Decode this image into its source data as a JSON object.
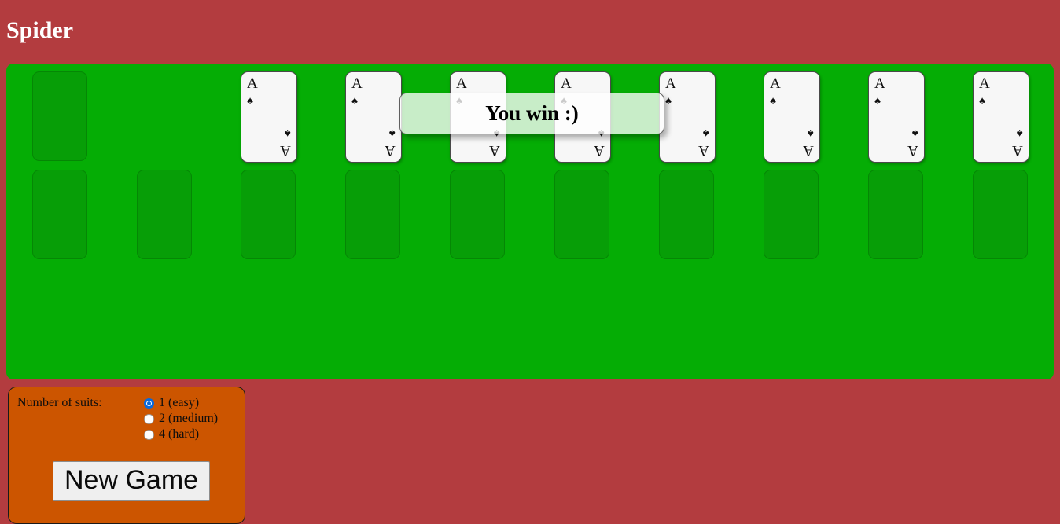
{
  "page": {
    "title": "Spider",
    "background_color": "#b33c3f"
  },
  "table": {
    "felt_color": "#05ad05",
    "slot_color": "#079e07",
    "columns": 10,
    "rows": [
      {
        "name": "top-row",
        "cells": [
          {
            "type": "empty"
          },
          {
            "type": "blank"
          },
          {
            "type": "card",
            "rank": "A",
            "suit": "♠",
            "suit_name": "spades",
            "color": "black"
          },
          {
            "type": "card",
            "rank": "A",
            "suit": "♠",
            "suit_name": "spades",
            "color": "black"
          },
          {
            "type": "card",
            "rank": "A",
            "suit": "♠",
            "suit_name": "spades",
            "color": "black"
          },
          {
            "type": "card",
            "rank": "A",
            "suit": "♠",
            "suit_name": "spades",
            "color": "black"
          },
          {
            "type": "card",
            "rank": "A",
            "suit": "♠",
            "suit_name": "spades",
            "color": "black"
          },
          {
            "type": "card",
            "rank": "A",
            "suit": "♠",
            "suit_name": "spades",
            "color": "black"
          },
          {
            "type": "card",
            "rank": "A",
            "suit": "♠",
            "suit_name": "spades",
            "color": "black"
          },
          {
            "type": "card",
            "rank": "A",
            "suit": "♠",
            "suit_name": "spades",
            "color": "black"
          }
        ]
      },
      {
        "name": "second-row",
        "cells": [
          {
            "type": "empty"
          },
          {
            "type": "empty"
          },
          {
            "type": "empty"
          },
          {
            "type": "empty"
          },
          {
            "type": "empty"
          },
          {
            "type": "empty"
          },
          {
            "type": "empty"
          },
          {
            "type": "empty"
          },
          {
            "type": "empty"
          },
          {
            "type": "empty"
          }
        ]
      }
    ]
  },
  "win_message": {
    "text": "You win :)"
  },
  "controls": {
    "panel_color": "#cc5500",
    "suits_label": "Number of suits:",
    "suit_options": [
      {
        "label": "1 (easy)",
        "value": "1",
        "selected": true
      },
      {
        "label": "2 (medium)",
        "value": "2",
        "selected": false
      },
      {
        "label": "4 (hard)",
        "value": "4",
        "selected": false
      }
    ],
    "new_game_label": "New Game"
  }
}
